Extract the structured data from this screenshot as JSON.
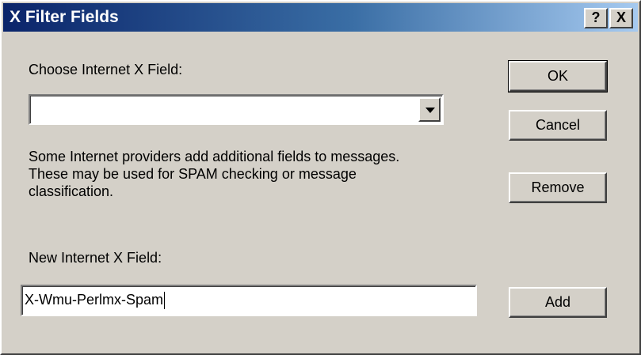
{
  "window": {
    "title": "X Filter Fields",
    "help_label": "?",
    "close_label": "X"
  },
  "choose": {
    "label": "Choose Internet X Field:",
    "selected_value": ""
  },
  "description": {
    "line1": "Some Internet providers add additional fields to messages.",
    "line2": "These may be used for SPAM checking or message",
    "line3": "classification."
  },
  "new_field": {
    "label": "New Internet X Field:",
    "value": "X-Wmu-Perlmx-Spam"
  },
  "buttons": {
    "ok": "OK",
    "cancel": "Cancel",
    "remove": "Remove",
    "add": "Add"
  }
}
